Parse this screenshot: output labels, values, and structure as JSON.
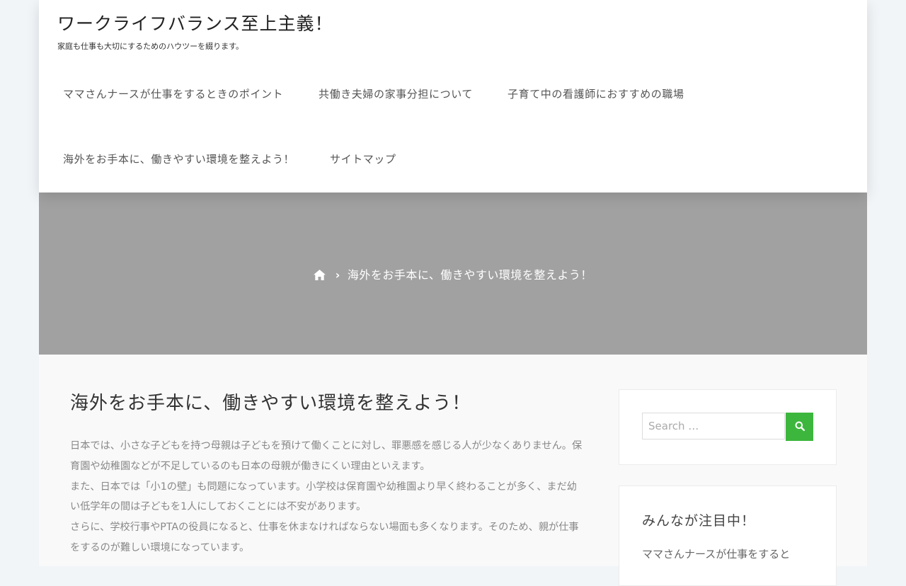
{
  "site": {
    "title": "ワークライフバランス至上主義！",
    "tagline": "家庭も仕事も大切にするためのハウツーを綴ります。"
  },
  "nav": {
    "items": [
      {
        "label": "ママさんナースが仕事をするときのポイント"
      },
      {
        "label": "共働き夫婦の家事分担について"
      },
      {
        "label": "子育て中の看護師におすすめの職場"
      },
      {
        "label": "海外をお手本に、働きやすい環境を整えよう！"
      },
      {
        "label": "サイトマップ"
      }
    ]
  },
  "breadcrumb": {
    "home_icon": "home-icon",
    "separator_icon": "chevron-right-icon",
    "current": "海外をお手本に、働きやすい環境を整えよう！"
  },
  "post": {
    "title": "海外をお手本に、働きやすい環境を整えよう！",
    "paragraphs": [
      "日本では、小さな子どもを持つ母親は子どもを預けて働くことに対し、罪悪感を感じる人が少なくありません。保育園や幼稚園などが不足しているのも日本の母親が働きにくい理由といえます。",
      "また、日本では「小1の壁」も問題になっています。小学校は保育園や幼稚園より早く終わることが多く、まだ幼い低学年の間は子どもを1人にしておくことには不安があります。",
      "さらに、学校行事やPTAの役員になると、仕事を休まなければならない場面も多くなります。そのため、親が仕事をするのが難しい環境になっています。"
    ]
  },
  "sidebar": {
    "search": {
      "placeholder": "Search …",
      "value": "",
      "button_icon": "search-icon"
    },
    "popular": {
      "title": "みんなが注目中！",
      "link": "ママさんナースが仕事をすると"
    }
  },
  "colors": {
    "accent": "#3db63d",
    "hero_bg": "#a1a1a1",
    "page_bg": "#f1f5f8"
  }
}
